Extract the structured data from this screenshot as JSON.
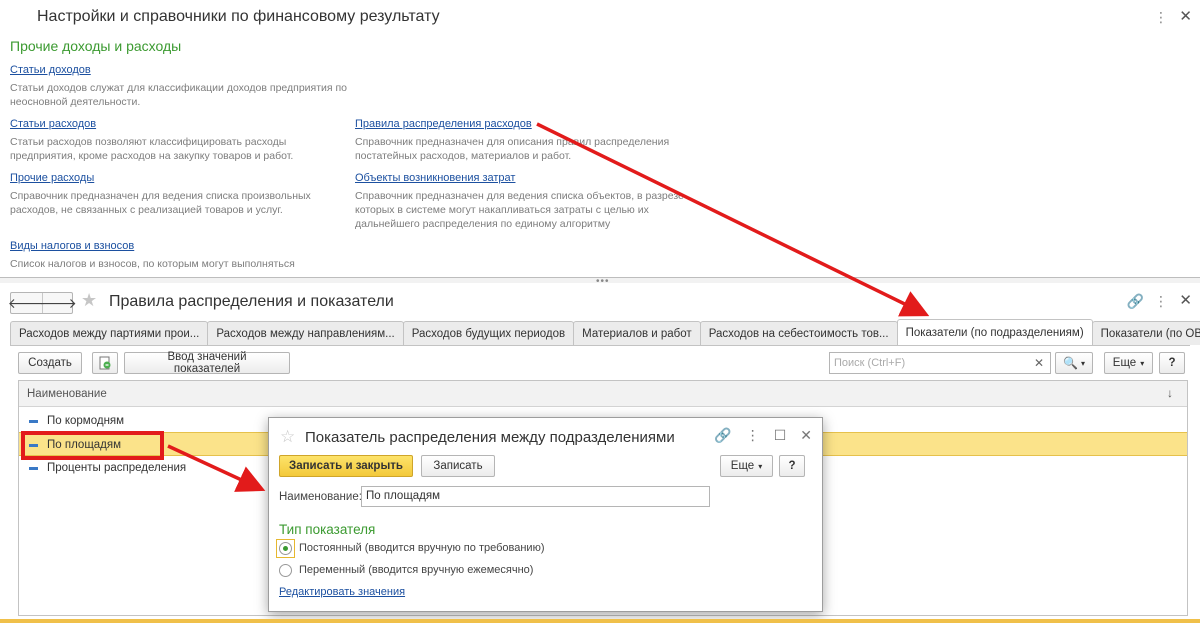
{
  "top": {
    "title": "Настройки и справочники по финансовому результату",
    "section": "Прочие доходы и расходы",
    "items": [
      {
        "label": "Статьи доходов",
        "desc": "Статьи доходов служат для классификации доходов предприятия по неосновной деятельности."
      },
      {
        "label": "Статьи расходов",
        "desc": "Статьи расходов позволяют классифицировать расходы предприятия, кроме расходов на закупку товаров и работ."
      },
      {
        "label": "Прочие расходы",
        "desc": "Справочник предназначен для ведения списка произвольных расходов, не связанных с реализацией товаров и услуг."
      },
      {
        "label": "Виды налогов и взносов",
        "desc": "Список налогов и взносов, по которым могут выполняться"
      },
      {
        "label": "Правила распределения расходов",
        "desc": "Справочник предназначен для описания правил распределения постатейных расходов, материалов и работ."
      },
      {
        "label": "Объекты возникновения затрат",
        "desc": "Справочник предназначен для ведения списка объектов, в разрезе которых в системе могут накапливаться затраты с целью их дальнейшего распределения по единому алгоритму"
      }
    ]
  },
  "form": {
    "title": "Правила распределения и показатели",
    "tabs": [
      "Расходов между партиями прои...",
      "Расходов между направлениям...",
      "Расходов будущих периодов",
      "Материалов и работ",
      "Расходов на себестоимость тов...",
      "Показатели (по подразделениям)",
      "Показатели (по ОВЗ)"
    ],
    "toolbar": {
      "create": "Создать",
      "enter_values": "Ввод значений показателей",
      "search_placeholder": "Поиск (Ctrl+F)",
      "more": "Еще",
      "help": "?"
    },
    "list": {
      "column": "Наименование",
      "rows": [
        "По кормодням",
        "По площадям",
        "Проценты распределения"
      ]
    }
  },
  "dialog": {
    "title": "Показатель распределения между подразделениями",
    "save_close": "Записать и закрыть",
    "save": "Записать",
    "more": "Еще",
    "help": "?",
    "name_label": "Наименование:",
    "name_value": "По площадям",
    "group": "Тип показателя",
    "option1": "Постоянный (вводится вручную по требованию)",
    "option2": "Переменный (вводится вручную ежемесячно)",
    "edit_link": "Редактировать значения"
  },
  "colors": {
    "accent_green": "#3b9a30",
    "link_blue": "#1c50a0",
    "selection": "#fbe38a",
    "annotation_red": "#e21b1b"
  }
}
